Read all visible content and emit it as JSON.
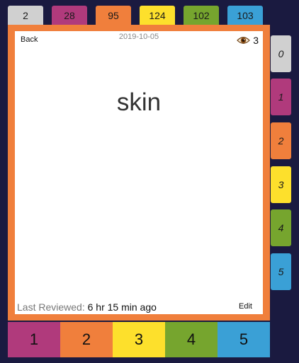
{
  "top_tabs": [
    {
      "count": "2",
      "color": "#d0d0d0"
    },
    {
      "count": "28",
      "color": "#b03a7c"
    },
    {
      "count": "95",
      "color": "#f07f3c"
    },
    {
      "count": "124",
      "color": "#fde02c"
    },
    {
      "count": "102",
      "color": "#76a52e"
    },
    {
      "count": "103",
      "color": "#3aa0d6"
    }
  ],
  "side_tabs": [
    {
      "label": "0",
      "color": "#d0d0d0"
    },
    {
      "label": "1",
      "color": "#b03a7c"
    },
    {
      "label": "2",
      "color": "#f07f3c"
    },
    {
      "label": "3",
      "color": "#fde02c"
    },
    {
      "label": "4",
      "color": "#76a52e"
    },
    {
      "label": "5",
      "color": "#3aa0d6"
    }
  ],
  "card": {
    "back_label": "Back",
    "date": "2019-10-05",
    "view_icon": "eye-icon",
    "view_count": "3",
    "word": "skin",
    "last_reviewed_label": "Last Reviewed:",
    "last_reviewed_value": "6 hr 15 min ago",
    "edit_label": "Edit",
    "frame_color": "#f07f3c"
  },
  "answer_buttons": [
    {
      "label": "1",
      "color": "#b03a7c"
    },
    {
      "label": "2",
      "color": "#f07f3c"
    },
    {
      "label": "3",
      "color": "#fde02c"
    },
    {
      "label": "4",
      "color": "#76a52e"
    },
    {
      "label": "5",
      "color": "#3aa0d6"
    }
  ]
}
